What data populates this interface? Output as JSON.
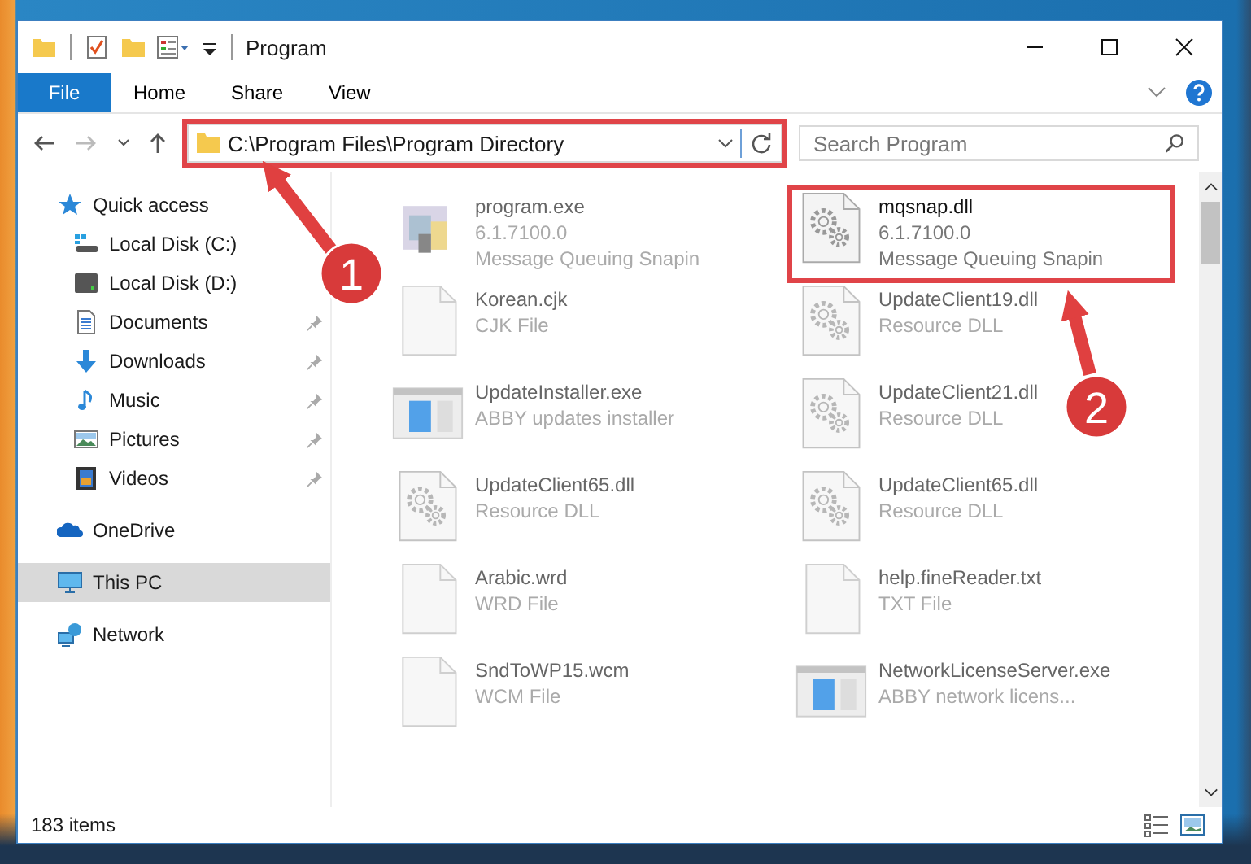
{
  "window": {
    "title": "Program"
  },
  "ribbon": {
    "file_button": "File",
    "tabs": [
      "Home",
      "Share",
      "View"
    ]
  },
  "address": {
    "path": "C:\\Program Files\\Program Directory",
    "highlighted": true
  },
  "search": {
    "placeholder": "Search Program"
  },
  "sidebar": {
    "items": [
      {
        "label": "Quick access",
        "selected": false,
        "children": [
          {
            "label": "Local Disk (C:)",
            "selected": false,
            "pinned": false
          },
          {
            "label": "Local Disk (D:)",
            "selected": false,
            "pinned": false
          },
          {
            "label": "Documents",
            "selected": false,
            "pinned": true
          },
          {
            "label": "Downloads",
            "selected": false,
            "pinned": true
          },
          {
            "label": "Music",
            "selected": false,
            "pinned": true
          },
          {
            "label": "Pictures",
            "selected": false,
            "pinned": true
          },
          {
            "label": "Videos",
            "selected": false,
            "pinned": true
          }
        ]
      },
      {
        "label": "OneDrive",
        "selected": false
      },
      {
        "label": "This PC",
        "selected": true
      },
      {
        "label": "Network",
        "selected": false
      }
    ]
  },
  "files": [
    {
      "name": "program.exe",
      "details": [
        "6.1.7100.0",
        "Message Queuing Snapin"
      ],
      "blurred": true,
      "highlighted": false
    },
    {
      "name": "mqsnap.dll",
      "details": [
        "6.1.7100.0",
        "Message Queuing Snapin"
      ],
      "blurred": false,
      "highlighted": true
    },
    {
      "name": "Korean.cjk",
      "details": [
        "CJK File"
      ],
      "blurred": true,
      "highlighted": false
    },
    {
      "name": "UpdateClient19.dll",
      "details": [
        "Resource DLL"
      ],
      "blurred": true,
      "highlighted": false
    },
    {
      "name": "UpdateInstaller.exe",
      "details": [
        "ABBY updates installer"
      ],
      "blurred": true,
      "highlighted": false
    },
    {
      "name": "UpdateClient21.dll",
      "details": [
        "Resource DLL"
      ],
      "blurred": true,
      "highlighted": false
    },
    {
      "name": "UpdateClient65.dll",
      "details": [
        "Resource DLL"
      ],
      "blurred": true,
      "highlighted": false
    },
    {
      "name": "UpdateClient65.dll",
      "details": [
        "Resource DLL"
      ],
      "blurred": true,
      "highlighted": false
    },
    {
      "name": "Arabic.wrd",
      "details": [
        "WRD File"
      ],
      "blurred": true,
      "highlighted": false
    },
    {
      "name": "help.fineReader.txt",
      "details": [
        "TXT File"
      ],
      "blurred": true,
      "highlighted": false
    },
    {
      "name": "SndToWP15.wcm",
      "details": [
        "WCM File"
      ],
      "blurred": true,
      "highlighted": false
    },
    {
      "name": "NetworkLicenseServer.exe",
      "details": [
        "ABBY network licens..."
      ],
      "blurred": true,
      "highlighted": false
    }
  ],
  "status_bar": {
    "count": "183 items"
  },
  "annotations": [
    {
      "number": "1"
    },
    {
      "number": "2"
    }
  ]
}
